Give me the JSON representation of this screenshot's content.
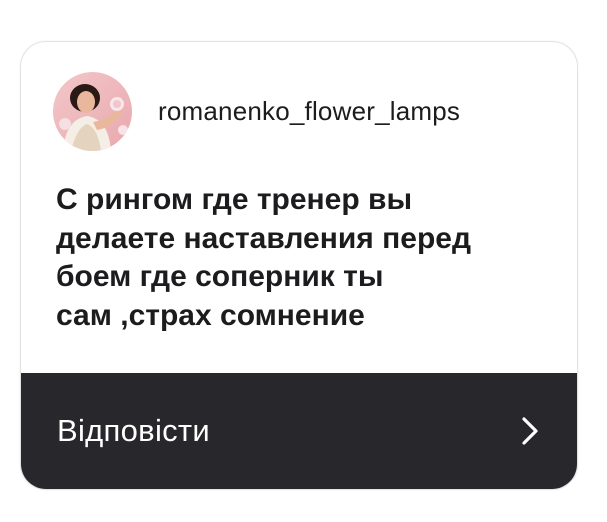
{
  "story_reply": {
    "avatar_icon": "profile-photo",
    "username": "romanenko_flower_lamps",
    "message": "С рингом где тренер вы\nделаете наставления перед\nбоем где соперник ты\nсам ,страх сомнение",
    "reply_label": "Відповісти",
    "chevron_icon": "chevron-right-icon"
  },
  "colors": {
    "reply_bar": "#28282c",
    "text": "#1c1c1e",
    "card_border": "#e3e3e6"
  }
}
